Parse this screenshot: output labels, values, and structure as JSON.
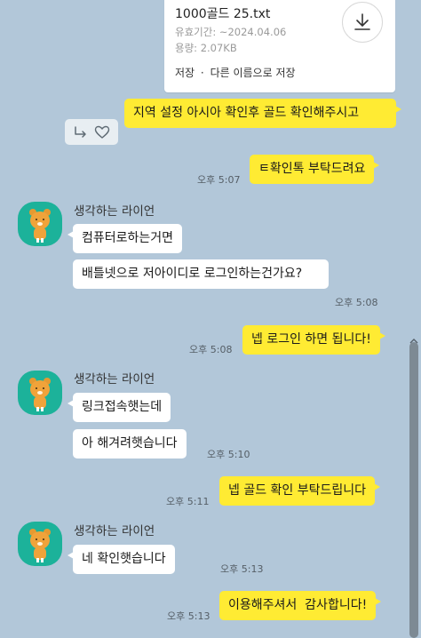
{
  "file": {
    "name": "1000골드 25.txt",
    "expiry": "유효기간: ~2024.04.06",
    "size": "용량: 2.07KB",
    "save_label": "저장",
    "separator": "·",
    "save_as_label": "다른 이름으로 저장"
  },
  "messages": {
    "m1": "지역 설정 아시아 확인후 골드 확인해주시고",
    "m2": "ㅌ확인톡 부탁드려요",
    "t2": "오후 5:07",
    "sender": "생각하는 라이언",
    "m3": "컴퓨터로하는거면",
    "m4": "배틀넷으로 저아이디로 로그인하는건가요?",
    "t4": "오후 5:08",
    "m5": "넵 로그인 하면 됩니다!",
    "t5": "오후 5:08",
    "m6": "링크접속햇는데",
    "m7": "아 해겨려햇습니다",
    "t7": "오후 5:10",
    "m8": "넵 골드 확인 부탁드립니다",
    "t8": "오후 5:11",
    "m9": "네 확인햇습니다",
    "t9": "오후 5:13",
    "m10": "이용해주셔서  감사합니다!",
    "t10": "오후 5:13"
  },
  "icons": {
    "download": "download-icon",
    "share": "share-icon",
    "like": "heart-icon",
    "avatar": "ryan-avatar"
  },
  "colors": {
    "background": "#b2c7d9",
    "my_bubble": "#ffeb33",
    "their_bubble": "#ffffff",
    "avatar_bg": "#1cb29a"
  }
}
